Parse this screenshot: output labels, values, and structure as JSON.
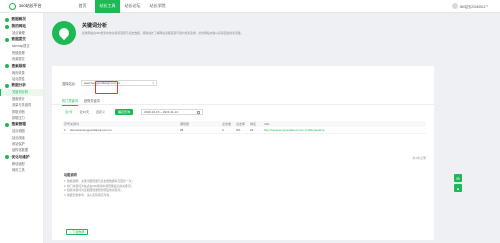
{
  "app": {
    "logo_text": "360站长平台"
  },
  "topnav": [
    {
      "label": "首页",
      "active": false
    },
    {
      "label": "站长工具",
      "active": true
    },
    {
      "label": "站长论坛",
      "active": false
    },
    {
      "label": "站长学院",
      "active": false
    }
  ],
  "user": {
    "name": "360站长20240512"
  },
  "sidebar": {
    "groups": [
      {
        "title": "数据概况",
        "icon": "home-icon",
        "items": []
      },
      {
        "title": "我的网站",
        "icon": "globe-icon",
        "items": [
          "站点管理"
        ]
      },
      {
        "title": "数据提交",
        "icon": "upload-icon",
        "items": [
          "sitemap提交",
          "死链处理",
          "资源提交"
        ]
      },
      {
        "title": "搜索展现",
        "icon": "search-icon",
        "items": [
          "网页收录",
          "站点属性"
        ]
      },
      {
        "title": "数据分析",
        "icon": "chart-icon",
        "items": [
          "关键词分析",
          "搜索统计",
          "流量与关键词",
          "抓取诊断",
          "抓取压力"
        ]
      },
      {
        "title": "搜索管理",
        "icon": "settings-icon",
        "items": [
          "站点地图",
          "站点改版",
          "闭站保护",
          "结构化数据"
        ]
      },
      {
        "title": "优化与维护",
        "icon": "wrench-icon",
        "items": [
          "移动适配",
          "网页工具"
        ]
      }
    ],
    "active_item": "关键词分析"
  },
  "hero": {
    "title": "关键词分析",
    "description": "提供网站在360搜索中的关键词展现与点击数据，帮助站长了解网站流量来源与用户搜索需求，优化网站内容以获得更多搜索流量。"
  },
  "site_select": {
    "label": "选择站点：",
    "value": "www.fengyundianqi.com.cn"
  },
  "tabs": [
    {
      "label": "热门关键词",
      "active": true
    },
    {
      "label": "趋势关键词",
      "active": false
    }
  ],
  "filters": {
    "options": [
      {
        "label": "近7天",
        "active": true
      },
      {
        "label": "近30天",
        "active": false
      },
      {
        "label": "自定义",
        "active": false
      }
    ],
    "update_button": "确定查询",
    "date_range": "2020-10-15 ~ 2020-11-13"
  },
  "table": {
    "headers": [
      "序号",
      "关键词",
      "展现量",
      "点击量",
      "点击率",
      "排名",
      "URL"
    ],
    "rows": [
      [
        "1",
        "site:www.fengyundianqi.com.cn",
        "28",
        "0",
        "0%",
        "24",
        "http://www.fengyundianqi.com.cn/list/xianlang"
      ]
    ]
  },
  "table_status": "共1条记录",
  "notes": {
    "title": "功能说明",
    "items": [
      "1. 数据说明：关键词展现量与点击量数据每天更新一次；",
      "2. 热门关键词为站点在360搜索中展现量最高的关键词；",
      "3. 趋势关键词为近期展现量增长明显的关键词；",
      "4. 数据仅供参考，请以实际情况为准。"
    ]
  },
  "download_button": "下载数据",
  "colors": {
    "accent": "#1db954",
    "highlight": "#e23b2e",
    "background": "#eef0f3"
  }
}
